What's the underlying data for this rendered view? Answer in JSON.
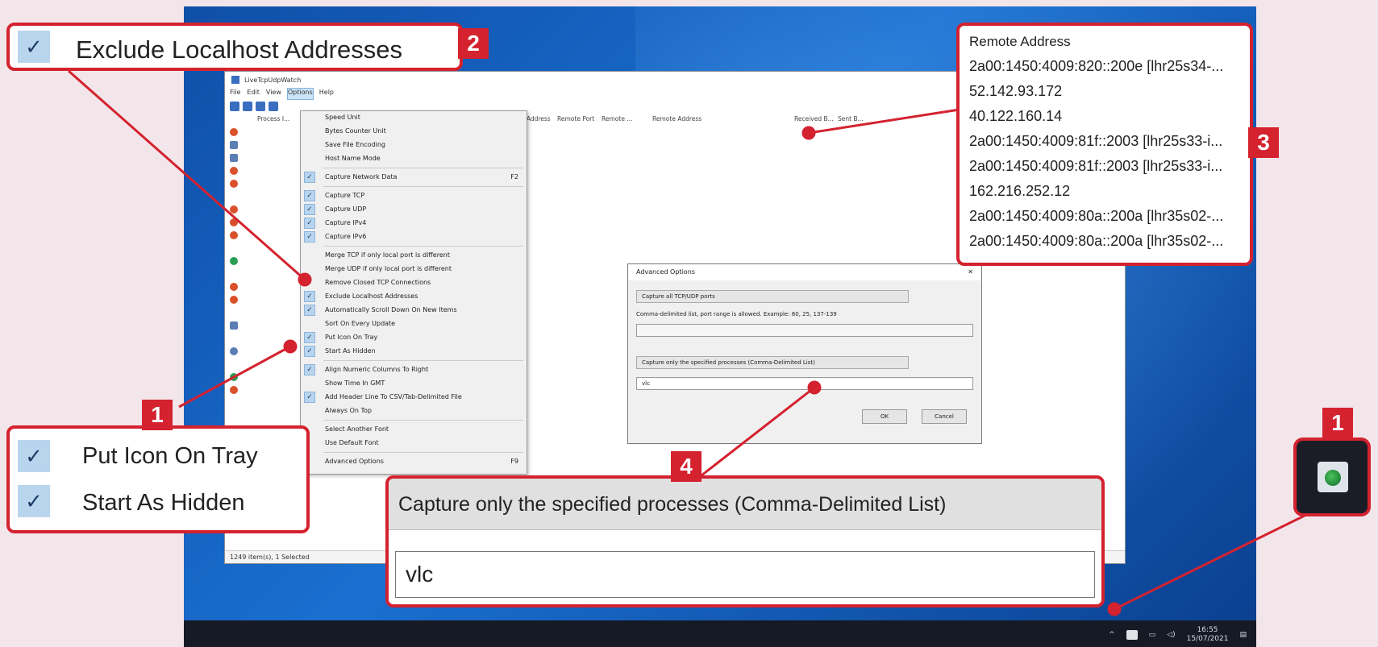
{
  "app": {
    "title": "LiveTcpUdpWatch",
    "menus": [
      "File",
      "Edit",
      "View",
      "Options",
      "Help"
    ],
    "columns": [
      "Process I...",
      "Local Address",
      "Remote Port",
      "Remote ...",
      "Remote Address",
      "Received B...",
      "Sent B..."
    ],
    "status": "1249 item(s), 1 Selected"
  },
  "options_menu": {
    "items": [
      {
        "label": "Speed Unit",
        "checked": false,
        "shortcut": ""
      },
      {
        "label": "Bytes Counter Unit",
        "checked": false,
        "shortcut": ""
      },
      {
        "label": "Save File Encoding",
        "checked": false,
        "shortcut": ""
      },
      {
        "label": "Host Name Mode",
        "checked": false,
        "shortcut": ""
      },
      {
        "label": "Capture Network Data",
        "checked": true,
        "shortcut": "F2"
      },
      {
        "label": "Capture TCP",
        "checked": true,
        "shortcut": ""
      },
      {
        "label": "Capture UDP",
        "checked": true,
        "shortcut": ""
      },
      {
        "label": "Capture IPv4",
        "checked": true,
        "shortcut": ""
      },
      {
        "label": "Capture IPv6",
        "checked": true,
        "shortcut": ""
      },
      {
        "label": "Merge TCP if only local port is different",
        "checked": false,
        "shortcut": ""
      },
      {
        "label": "Merge UDP if only local port is different",
        "checked": false,
        "shortcut": ""
      },
      {
        "label": "Remove Closed TCP Connections",
        "checked": false,
        "shortcut": ""
      },
      {
        "label": "Exclude Localhost Addresses",
        "checked": true,
        "shortcut": ""
      },
      {
        "label": "Automatically Scroll Down On New Items",
        "checked": true,
        "shortcut": ""
      },
      {
        "label": "Sort On Every Update",
        "checked": false,
        "shortcut": ""
      },
      {
        "label": "Put Icon On Tray",
        "checked": true,
        "shortcut": ""
      },
      {
        "label": "Start As Hidden",
        "checked": true,
        "shortcut": ""
      },
      {
        "label": "Align Numeric Columns To Right",
        "checked": true,
        "shortcut": ""
      },
      {
        "label": "Show Time In GMT",
        "checked": false,
        "shortcut": ""
      },
      {
        "label": "Add Header Line To CSV/Tab-Delimited File",
        "checked": true,
        "shortcut": ""
      },
      {
        "label": "Always On Top",
        "checked": false,
        "shortcut": ""
      },
      {
        "label": "Select Another Font",
        "checked": false,
        "shortcut": ""
      },
      {
        "label": "Use Default Font",
        "checked": false,
        "shortcut": ""
      },
      {
        "label": "Advanced Options",
        "checked": false,
        "shortcut": "F9"
      }
    ]
  },
  "advanced_dialog": {
    "title": "Advanced Options",
    "close": "✕",
    "ports_select": "Capture all TCP/UDP ports",
    "ports_hint": "Comma-delimited list, port range is allowed. Example: 80, 25, 137-139",
    "process_select": "Capture only the specified processes (Comma-Delimited List)",
    "process_value": "vlc",
    "ok": "OK",
    "cancel": "Cancel"
  },
  "callouts": {
    "exclude_localhost": {
      "check": "✓",
      "label": "Exclude Localhost Addresses",
      "badge": "2"
    },
    "tray_options": {
      "check": "✓",
      "items": [
        "Put Icon On Tray",
        "Start As Hidden"
      ],
      "badge": "1"
    },
    "remote_address": {
      "badge": "3",
      "header": "Remote Address",
      "rows": [
        "2a00:1450:4009:820::200e  [lhr25s34-...",
        "52.142.93.172",
        "40.122.160.14",
        "2a00:1450:4009:81f::2003  [lhr25s33-i...",
        "2a00:1450:4009:81f::2003  [lhr25s33-i...",
        "162.216.252.12",
        "2a00:1450:4009:80a::200a  [lhr35s02-...",
        "2a00:1450:4009:80a::200a  [lhr35s02-..."
      ]
    },
    "capture_process": {
      "badge": "4",
      "header": "Capture only the specified processes (Comma-Delimited List)",
      "value": "vlc"
    },
    "tray_icon": {
      "badge": "1"
    }
  },
  "taskbar": {
    "time": "16:55",
    "date": "15/07/2021",
    "chevron": "^"
  },
  "colors": {
    "accent_red": "#d4222f",
    "check_bg": "#b9d5ee",
    "desktop_blue": "#1a6fd0"
  }
}
